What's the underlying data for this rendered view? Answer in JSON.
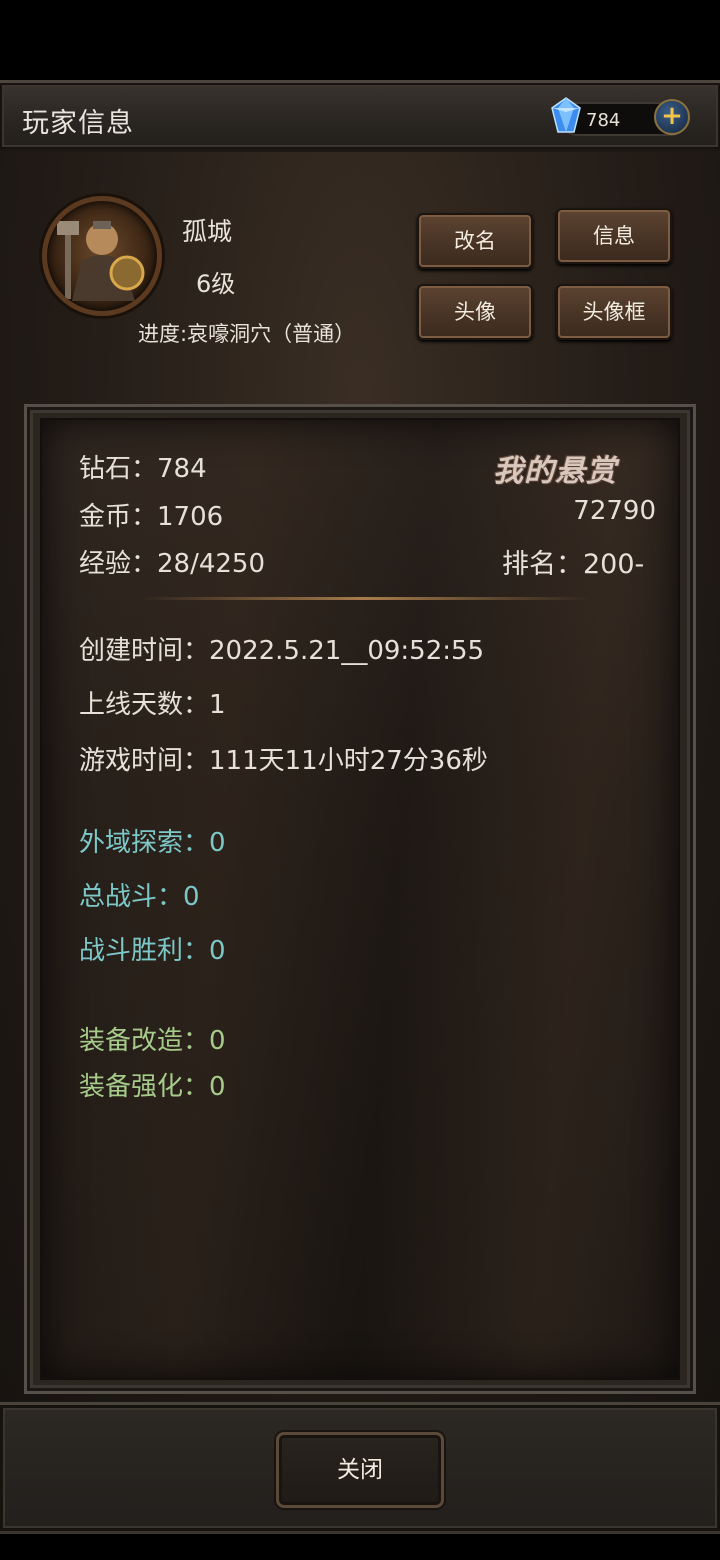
{
  "header": {
    "title": "玩家信息",
    "diamond_count": "784",
    "plus_label": "+"
  },
  "profile": {
    "name": "孤城",
    "level": "6级",
    "progress": "进度:哀嚎洞穴（普通）"
  },
  "buttons": {
    "rename": "改名",
    "info": "信息",
    "avatar": "头像",
    "avatar_frame": "头像框"
  },
  "stats": {
    "diamond": "钻石：784",
    "gold": "金币：1706",
    "exp": "经验：28/4250",
    "bounty_title": "我的悬赏",
    "bounty_value": "72790",
    "rank": "排名：200-",
    "created": "创建时间：2022.5.21__09:52:55",
    "online_days": "上线天数：1",
    "play_time": "游戏时间：111天11小时27分36秒",
    "exploration": "外域探索：0",
    "total_battles": "总战斗：0",
    "battle_wins": "战斗胜利：0",
    "equip_modify": "装备改造：0",
    "equip_enhance": "装备强化：0"
  },
  "footer": {
    "close": "关闭"
  },
  "colors": {
    "cyan_stat": "#7cc8c8",
    "green_stat": "#a6cb8a",
    "text": "#e6e1d8"
  }
}
